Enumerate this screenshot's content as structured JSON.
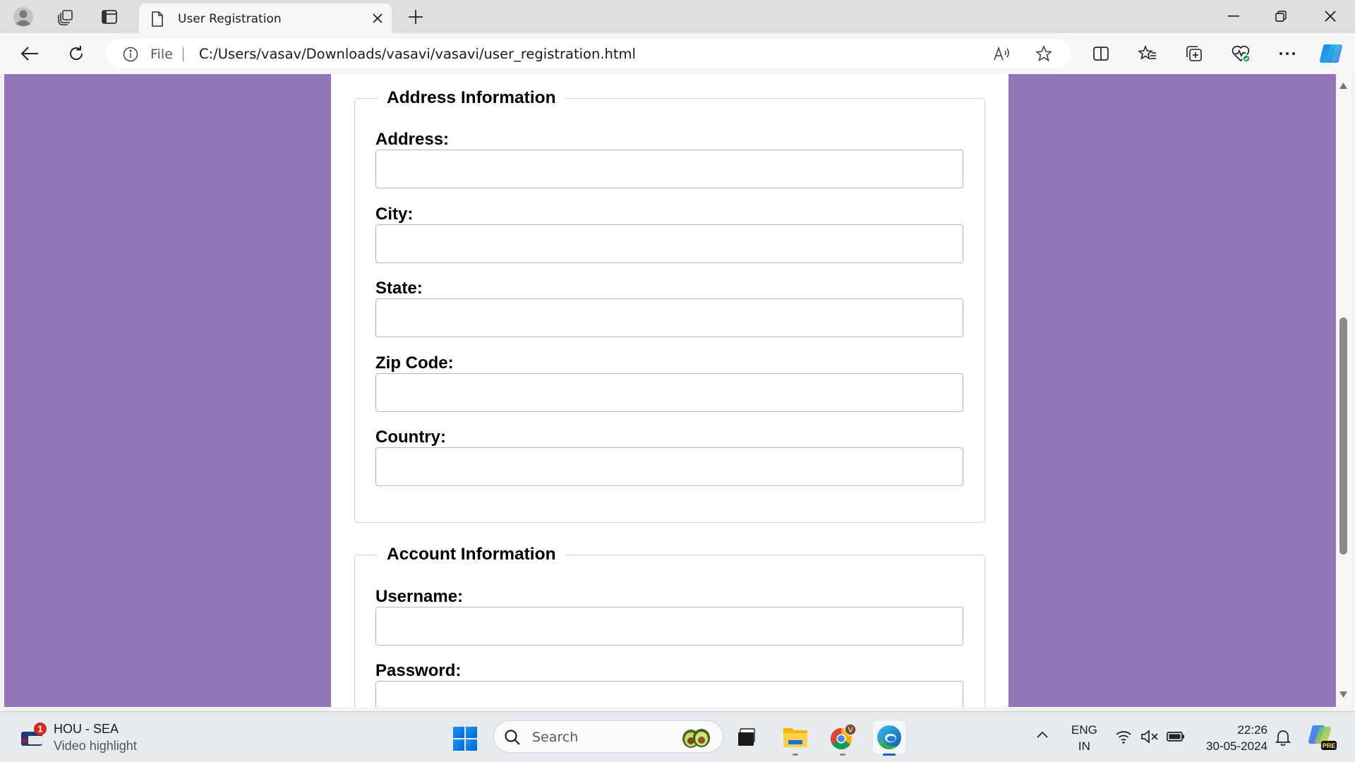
{
  "browser": {
    "tab": {
      "title": "User Registration"
    },
    "address": {
      "scheme_label": "File",
      "url": "C:/Users/vasav/Downloads/vasavi/vasavi/user_registration.html"
    }
  },
  "page": {
    "sections": [
      {
        "legend": "Address Information",
        "fields": [
          {
            "label": "Address:",
            "value": ""
          },
          {
            "label": "City:",
            "value": ""
          },
          {
            "label": "State:",
            "value": ""
          },
          {
            "label": "Zip Code:",
            "value": ""
          },
          {
            "label": "Country:",
            "value": ""
          }
        ]
      },
      {
        "legend": "Account Information",
        "fields": [
          {
            "label": "Username:",
            "value": ""
          },
          {
            "label": "Password:",
            "value": ""
          }
        ]
      }
    ]
  },
  "taskbar": {
    "widget": {
      "badge": "1",
      "title": "HOU - SEA",
      "subtitle": "Video highlight"
    },
    "search_label": "Search",
    "chrome_badge": "V",
    "lang": {
      "line1": "ENG",
      "line2": "IN"
    },
    "clock": {
      "time": "22:26",
      "date": "30-05-2024"
    },
    "copilot_badge": "PRE"
  },
  "colors": {
    "page_background": "#9575b9",
    "container_background": "#ffffff",
    "accent": "#005fb8"
  },
  "icons": [
    "profile-icon",
    "workspaces-icon",
    "tab-actions-icon",
    "page-icon",
    "close-icon",
    "plus-icon",
    "minimize-icon",
    "restore-icon",
    "back-icon",
    "refresh-icon",
    "info-icon",
    "read-aloud-icon",
    "star-icon",
    "split-screen-icon",
    "favorites-icon",
    "collections-icon",
    "browser-essentials-icon",
    "more-icon",
    "copilot-icon",
    "windows-icon",
    "search-icon",
    "file-explorer-icon",
    "chrome-icon",
    "edge-icon",
    "wifi-icon",
    "volume-muted-icon",
    "battery-icon",
    "bell-icon"
  ]
}
